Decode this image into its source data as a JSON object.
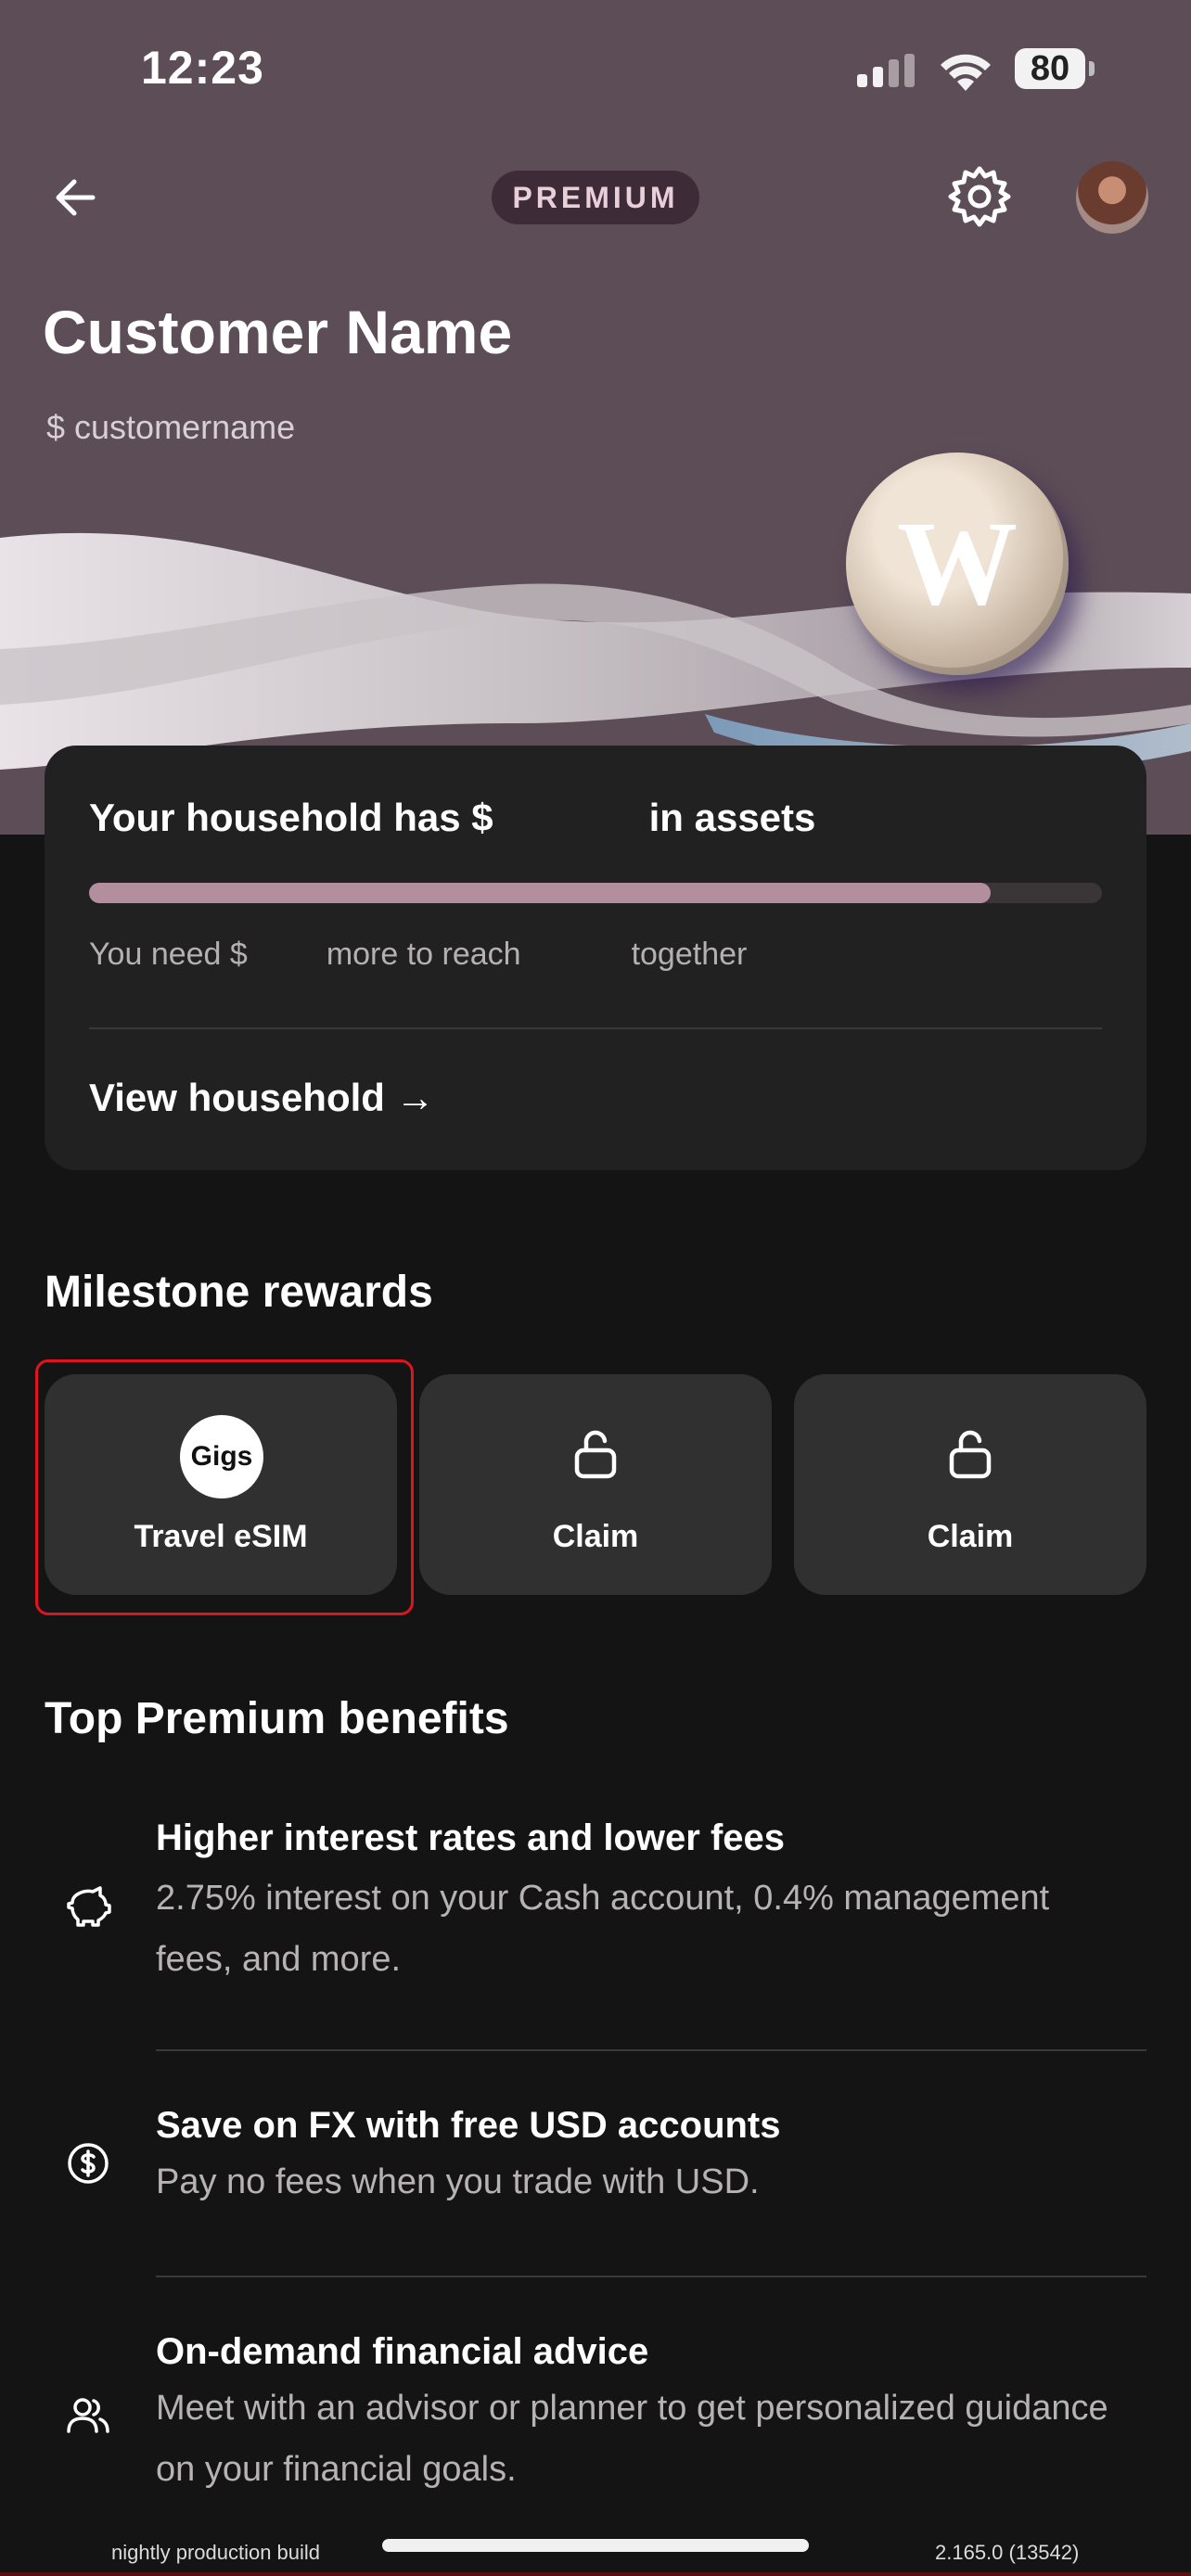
{
  "status_bar": {
    "time": "12:23",
    "battery": "80"
  },
  "header": {
    "badge": "PREMIUM"
  },
  "profile": {
    "name": "Customer Name",
    "handle": "$ customername"
  },
  "household": {
    "title": "Your household has $        in assets",
    "progress": 0.89,
    "need_text": "You need $     more to reach       together",
    "link": "View household →"
  },
  "milestone": {
    "title": "Milestone rewards",
    "items": [
      {
        "label": "Travel eSIM",
        "logo": "Gigs",
        "icon": "gigs-logo"
      },
      {
        "label": "Claim",
        "icon": "unlock-icon"
      },
      {
        "label": "Claim",
        "icon": "unlock-icon"
      }
    ]
  },
  "benefits": {
    "title": "Top Premium benefits",
    "items": [
      {
        "title": "Higher interest rates and lower fees",
        "desc": "2.75% interest on your Cash account, 0.4% management fees, and more.",
        "icon": "piggy-bank-icon"
      },
      {
        "title": "Save on FX with free USD accounts",
        "desc": "Pay no fees when you trade with USD.",
        "icon": "dollar-circle-icon"
      },
      {
        "title": "On-demand financial advice",
        "desc": "Meet with an advisor or planner to get personalized guidance on your financial goals.",
        "icon": "people-icon"
      }
    ]
  },
  "footer": {
    "build_label": "nightly production build",
    "version": "2.165.0 (13542)"
  },
  "colors": {
    "hero": "#5d4d57",
    "background": "#151414",
    "card": "#222122",
    "progress": "#b38f9d",
    "selection": "#e0141f"
  }
}
